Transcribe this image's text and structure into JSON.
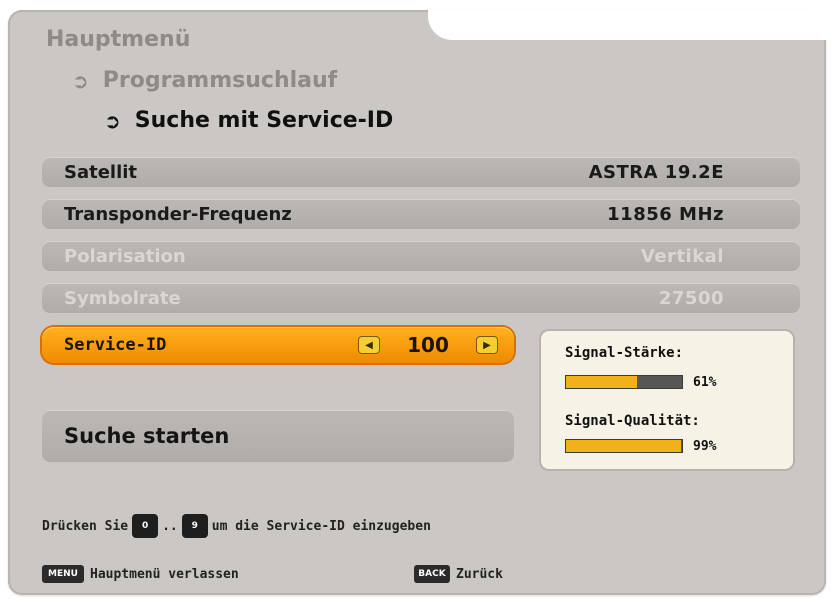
{
  "breadcrumb": {
    "main": "Hauptmenü",
    "level1": "Programmsuchlauf",
    "level2": "Suche mit Service-ID"
  },
  "rows": [
    {
      "label": "Satellit",
      "value": "ASTRA 19.2E",
      "enabled": true
    },
    {
      "label": "Transponder-Frequenz",
      "value": "11856 MHz",
      "enabled": true
    },
    {
      "label": "Polarisation",
      "value": "Vertikal",
      "enabled": false
    },
    {
      "label": "Symbolrate",
      "value": "27500",
      "enabled": false
    }
  ],
  "service": {
    "label": "Service-ID",
    "value": "100"
  },
  "start": {
    "label": "Suche starten"
  },
  "signal": {
    "strength_label": "Signal-Stärke:",
    "strength_value": "61%",
    "strength_level": 0.61,
    "quality_label": "Signal-Qualität:",
    "quality_value": "99%",
    "quality_level": 0.99,
    "bar_color": "#f2b019"
  },
  "hint": {
    "prefix": "Drücken Sie",
    "between": "..",
    "suffix": "um die Service-ID einzugeben"
  },
  "footer": {
    "menu_key": "MENU",
    "menu_label": "Hauptmenü verlassen",
    "back_key": "BACK",
    "back_label": "Zurück"
  },
  "colors": {
    "highlight": "#f59a10",
    "panel": "#cbc7c4"
  }
}
